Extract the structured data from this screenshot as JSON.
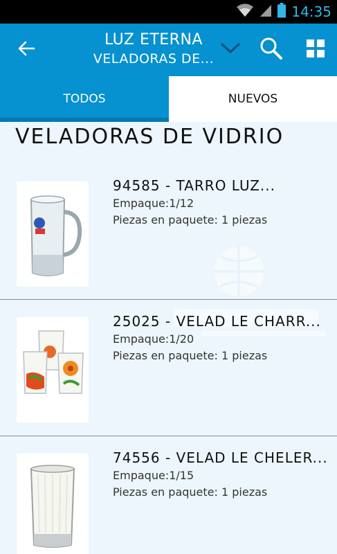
{
  "status_bar": {
    "time": "14:35"
  },
  "app_bar": {
    "title": "LUZ ETERNA",
    "subtitle": "VELADORAS DE...",
    "icons": {
      "back": "arrow-back-icon",
      "dropdown": "chevron-down-icon",
      "search": "search-icon",
      "view": "grid-view-icon"
    },
    "color": "#0691d0"
  },
  "tabs": [
    {
      "label": "TODOS",
      "selected": true
    },
    {
      "label": "NUEVOS",
      "selected": false
    }
  ],
  "section": {
    "title": "VELADORAS DE VIDRIO"
  },
  "products": [
    {
      "title": "94585 - TARRO LUZ...",
      "packing": "Empaque:1/12",
      "pieces": "Piezas en paquete: 1 piezas",
      "image": "glass-mug-candle"
    },
    {
      "title": "25025 - VELAD LE CHARR...",
      "packing": "Empaque:1/20",
      "pieces": "Piezas en paquete: 1 piezas",
      "image": "floral-glass-candles"
    },
    {
      "title": "74556 - VELAD LE CHELER...",
      "packing": "Empaque:1/15",
      "pieces": "Piezas en paquete: 1 piezas",
      "image": "white-glass-candle"
    }
  ]
}
